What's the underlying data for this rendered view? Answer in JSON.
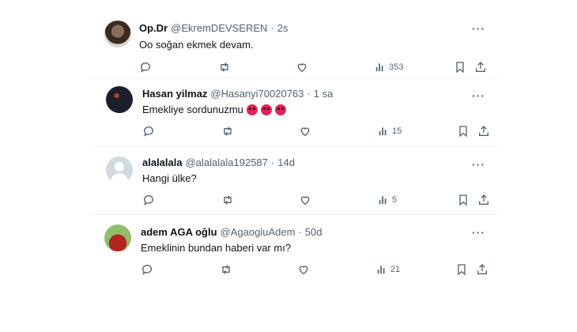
{
  "colors": {
    "text": "#0f1419",
    "muted": "#536471",
    "divider": "#eff3f4"
  },
  "tweets": [
    {
      "name": "Op.Dr",
      "handle": "@EkremDEVSEREN",
      "time": "2s",
      "text": "Oo soğan ekmek devam.",
      "views": "353",
      "avatar_icon": "photo-avatar"
    },
    {
      "name": "Hasan yilmaz",
      "handle": "@Hasanyi70020763",
      "time": "1 sa",
      "text": "Emekliye sordunuzmu",
      "emoji_count": 3,
      "views": "15",
      "avatar_icon": "photo-avatar"
    },
    {
      "name": "alalalala",
      "handle": "@alalalala192587",
      "time": "14d",
      "text": "Hangi ülke?",
      "views": "5",
      "avatar_icon": "default-avatar"
    },
    {
      "name": "adem AGA oğlu",
      "handle": "@AgaogluAdem",
      "time": "50d",
      "text": "Emeklinin bundan haberi var mı?",
      "views": "21",
      "avatar_icon": "photo-avatar"
    }
  ],
  "separator": "·",
  "more_label": "···"
}
